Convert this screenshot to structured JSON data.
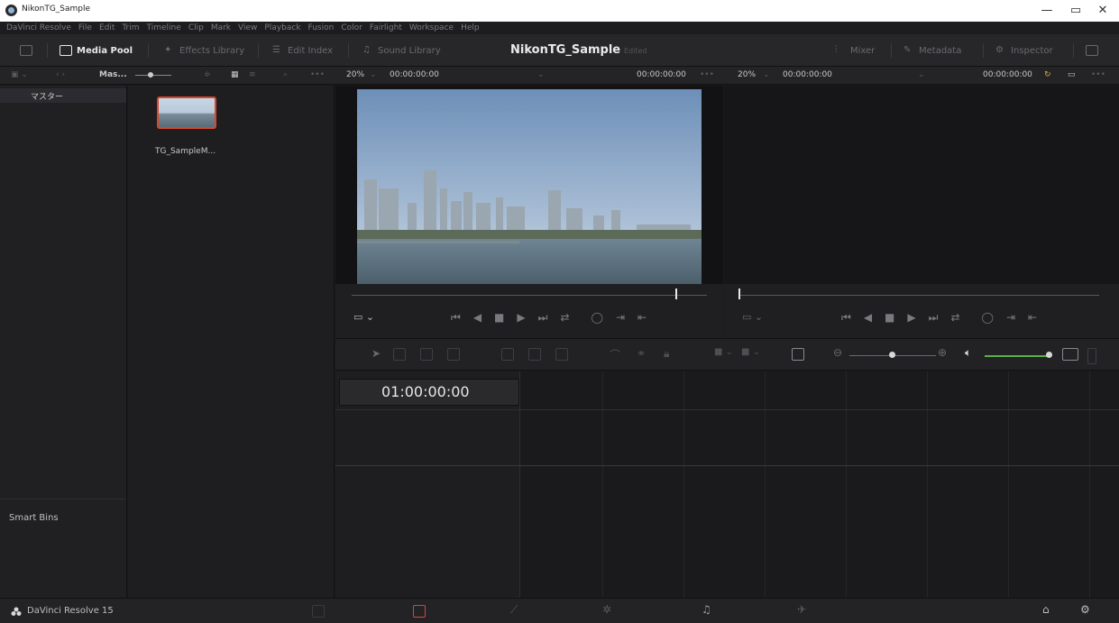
{
  "window": {
    "title": "NikonTG_Sample",
    "minimize": "—",
    "maximize": "▭",
    "close": "✕"
  },
  "menu": [
    "DaVinci Resolve",
    "File",
    "Edit",
    "Trim",
    "Timeline",
    "Clip",
    "Mark",
    "View",
    "Playback",
    "Fusion",
    "Color",
    "Fairlight",
    "Workspace",
    "Help"
  ],
  "toolbar": {
    "media_pool": "Media Pool",
    "effects_library": "Effects Library",
    "edit_index": "Edit Index",
    "sound_library": "Sound Library",
    "project_title": "NikonTG_Sample",
    "edited": "Edited",
    "mixer": "Mixer",
    "metadata": "Metadata",
    "inspector": "Inspector"
  },
  "subheader": {
    "bin_path": "Mas...",
    "source_zoom": "20%",
    "source_tc_left": "00:00:00:00",
    "source_tc_right": "00:00:00:00",
    "record_zoom": "20%",
    "record_tc_left": "00:00:00:00",
    "record_tc_right": "00:00:00:00"
  },
  "bins": {
    "master": "マスター",
    "smart_bins": "Smart Bins"
  },
  "media_pool": {
    "clip_name": "TG_SampleM..."
  },
  "timeline": {
    "timecode": "01:00:00:00"
  },
  "bottombar": {
    "brand": "DaVinci Resolve 15"
  },
  "playback": {
    "source_position": 0.91,
    "record_position": 0.0
  },
  "colors": {
    "accent": "#d9472b",
    "volume": "#5ab04a"
  }
}
